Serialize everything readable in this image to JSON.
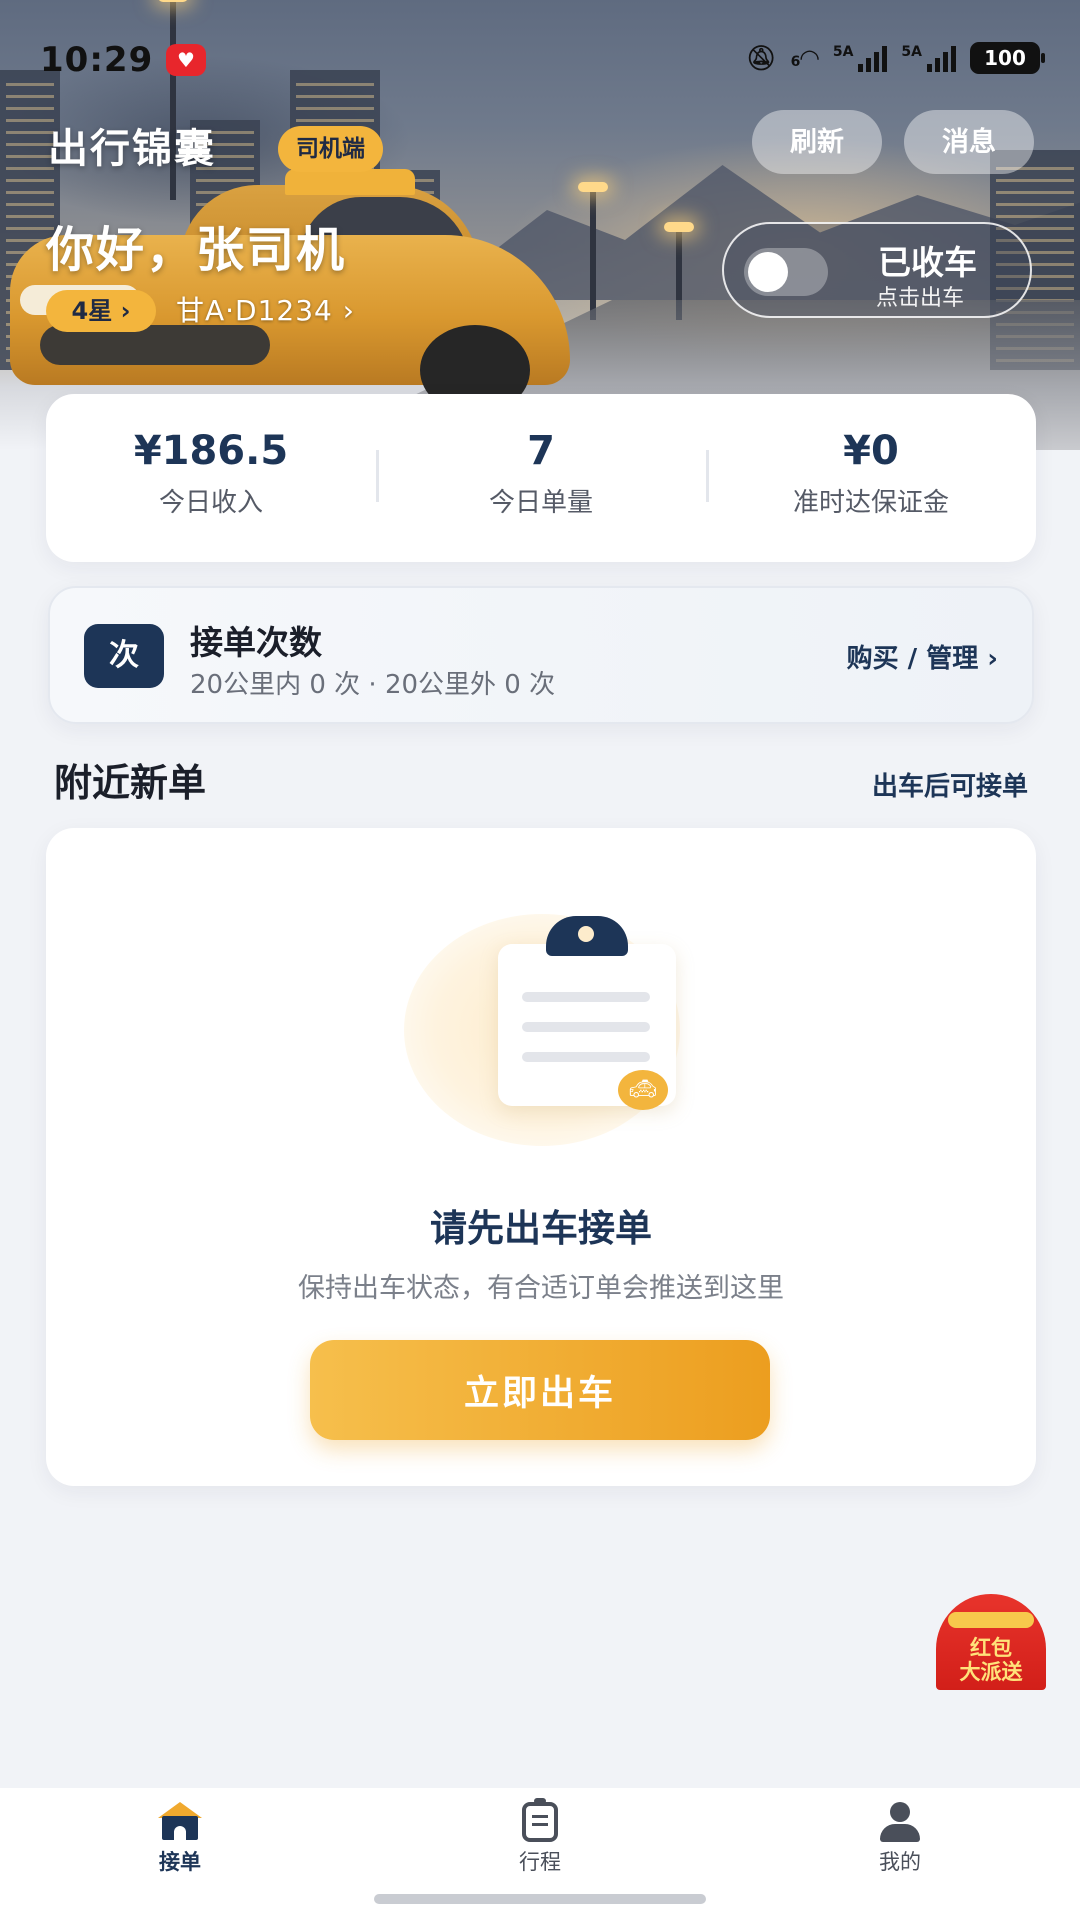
{
  "status_bar": {
    "time": "10:29",
    "network_1": "5A",
    "network_2": "5A",
    "battery": "100",
    "wifi_badge": "6"
  },
  "header": {
    "app_title": "出行锦囊",
    "role_badge": "司机端",
    "refresh_label": "刷新",
    "messages_label": "消息",
    "greeting": "你好，张司机",
    "rating": "4星 ›",
    "plate": "甘A·D1234 ›",
    "online_status": "已收车",
    "online_hint": "点击出车"
  },
  "stats": [
    {
      "value": "¥186.5",
      "label": "今日收入"
    },
    {
      "value": "7",
      "label": "今日单量"
    },
    {
      "value": "¥0",
      "label": "准时达保证金"
    }
  ],
  "quota": {
    "icon_char": "次",
    "title": "接单次数",
    "detail": "20公里内 0 次 · 20公里外 0 次",
    "action": "购买 / 管理 ›"
  },
  "nearby": {
    "title": "附近新单",
    "hint": "出车后可接单",
    "empty_title": "请先出车接单",
    "empty_desc": "保持出车状态，有合适订单会推送到这里",
    "cta": "立即出车"
  },
  "promo": {
    "line1": "红包",
    "line2": "大派送"
  },
  "nav": [
    {
      "label": "接单",
      "icon": "home-icon",
      "active": true
    },
    {
      "label": "行程",
      "icon": "clipboard-icon",
      "active": false
    },
    {
      "label": "我的",
      "icon": "user-icon",
      "active": false
    }
  ],
  "colors": {
    "primary_navy": "#1d3557",
    "accent_orange": "#f3b53d",
    "cta_gradient_end": "#ec9e1f",
    "promo_red": "#e8342c"
  }
}
